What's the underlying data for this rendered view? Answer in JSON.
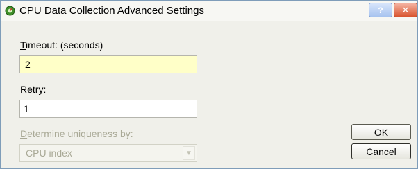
{
  "window": {
    "title": "CPU Data Collection Advanced Settings",
    "help_label": "?",
    "close_label": "✕"
  },
  "timeout": {
    "label_mnemonic": "T",
    "label_rest": "imeout: (seconds)",
    "value": "2"
  },
  "retry": {
    "label_mnemonic": "R",
    "label_rest": "etry:",
    "value": "1"
  },
  "uniqueness": {
    "label_mnemonic": "D",
    "label_rest": "etermine uniqueness by:",
    "selected": "CPU index"
  },
  "buttons": {
    "ok_label": "OK",
    "cancel_label": "Cancel"
  },
  "colors": {
    "focused_field_bg": "#ffffc8",
    "dialog_bg": "#f0f0ea",
    "disabled_text": "#a9a996"
  }
}
